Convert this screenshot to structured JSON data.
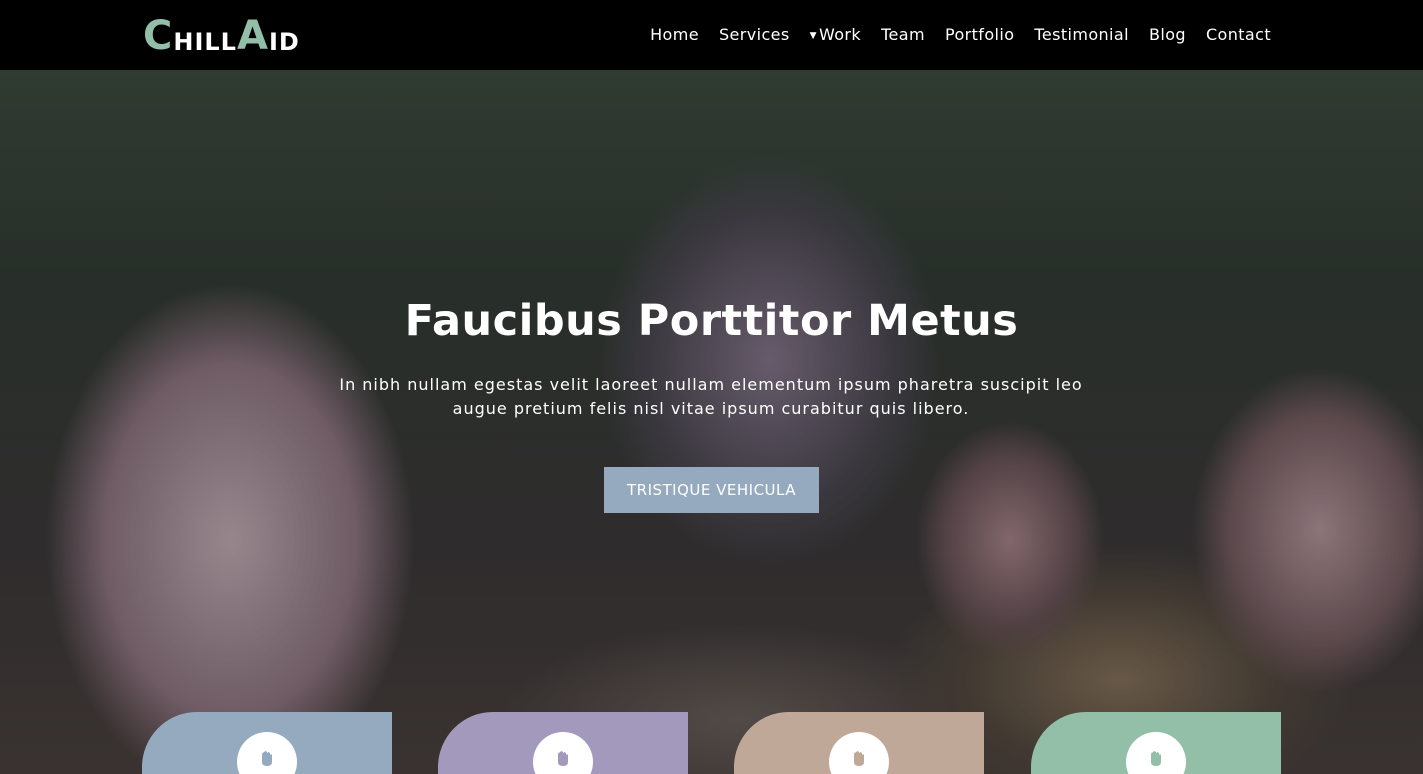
{
  "brand": {
    "logo_c": "C",
    "logo_hill": "HILL",
    "logo_a": "A",
    "logo_id": "ID",
    "accent_color": "#93bfa8"
  },
  "nav": {
    "items": [
      {
        "label": "Home"
      },
      {
        "label": "Services"
      },
      {
        "label": "Work",
        "has_dropdown": true
      },
      {
        "label": "Team"
      },
      {
        "label": "Portfolio"
      },
      {
        "label": "Testimonial"
      },
      {
        "label": "Blog"
      },
      {
        "label": "Contact"
      }
    ]
  },
  "hero": {
    "title": "Faucibus Porttitor Metus",
    "text": "In nibh nullam egestas velit laoreet nullam elementum ipsum pharetra suscipit leo augue pretium felis nisl vitae ipsum curabitur quis libero.",
    "button_label": "TRISTIQUE VEHICULA",
    "button_color": "#96aabf"
  },
  "cards": [
    {
      "color": "#96aabf",
      "icon": "hand-icon"
    },
    {
      "color": "#a399bd",
      "icon": "hand-icon"
    },
    {
      "color": "#c0a899",
      "icon": "hand-icon"
    },
    {
      "color": "#93bfa8",
      "icon": "hand-icon"
    }
  ]
}
